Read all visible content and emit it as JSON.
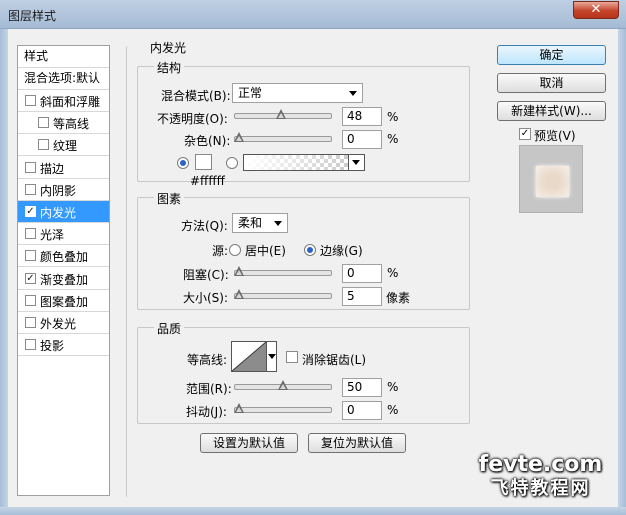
{
  "window": {
    "title": "图层样式",
    "close_glyph": "✕"
  },
  "left_panel": {
    "header": "样式",
    "blend_default": "混合选项:默认",
    "items": [
      {
        "label": "斜面和浮雕",
        "checked": false,
        "sub": false
      },
      {
        "label": "等高线",
        "checked": false,
        "sub": true
      },
      {
        "label": "纹理",
        "checked": false,
        "sub": true
      },
      {
        "label": "描边",
        "checked": false,
        "sub": false
      },
      {
        "label": "内阴影",
        "checked": false,
        "sub": false
      },
      {
        "label": "内发光",
        "checked": true,
        "sub": false,
        "selected": true
      },
      {
        "label": "光泽",
        "checked": false,
        "sub": false
      },
      {
        "label": "颜色叠加",
        "checked": false,
        "sub": false
      },
      {
        "label": "渐变叠加",
        "checked": true,
        "sub": false
      },
      {
        "label": "图案叠加",
        "checked": false,
        "sub": false
      },
      {
        "label": "外发光",
        "checked": false,
        "sub": false
      },
      {
        "label": "投影",
        "checked": false,
        "sub": false
      }
    ],
    "check_glyph": "✓"
  },
  "panel_title": "内发光",
  "structure": {
    "label": "结构",
    "blend_mode_label": "混合模式(B):",
    "blend_mode_value": "正常",
    "opacity_label": "不透明度(O):",
    "opacity_value": "48",
    "noise_label": "杂色(N):",
    "noise_value": "0",
    "percent": "%",
    "color_hex": "#ffffff",
    "swatch_color": "#ffffff"
  },
  "elements": {
    "label": "图素",
    "technique_label": "方法(Q):",
    "technique_value": "柔和",
    "source_label": "源:",
    "source_center": "居中(E)",
    "source_edge": "边缘(G)",
    "choke_label": "阻塞(C):",
    "choke_value": "0",
    "size_label": "大小(S):",
    "size_value": "5",
    "size_unit": "像素",
    "percent": "%"
  },
  "quality": {
    "label": "品质",
    "contour_label": "等高线:",
    "antialias_label": "消除锯齿(L)",
    "range_label": "范围(R):",
    "range_value": "50",
    "jitter_label": "抖动(J):",
    "jitter_value": "0",
    "percent": "%"
  },
  "bottom_buttons": {
    "make_default": "设置为默认值",
    "reset_default": "复位为默认值"
  },
  "right_buttons": {
    "ok": "确定",
    "cancel": "取消",
    "new_style": "新建样式(W)...",
    "preview_label": "预览(V)",
    "preview_checked": true
  },
  "slider_levels": {
    "opacity": 48,
    "noise": 0,
    "choke": 0,
    "size": 5,
    "range": 50,
    "jitter": 0
  },
  "watermark": {
    "line1": "fevte.com",
    "line2": "飞特教程网"
  }
}
